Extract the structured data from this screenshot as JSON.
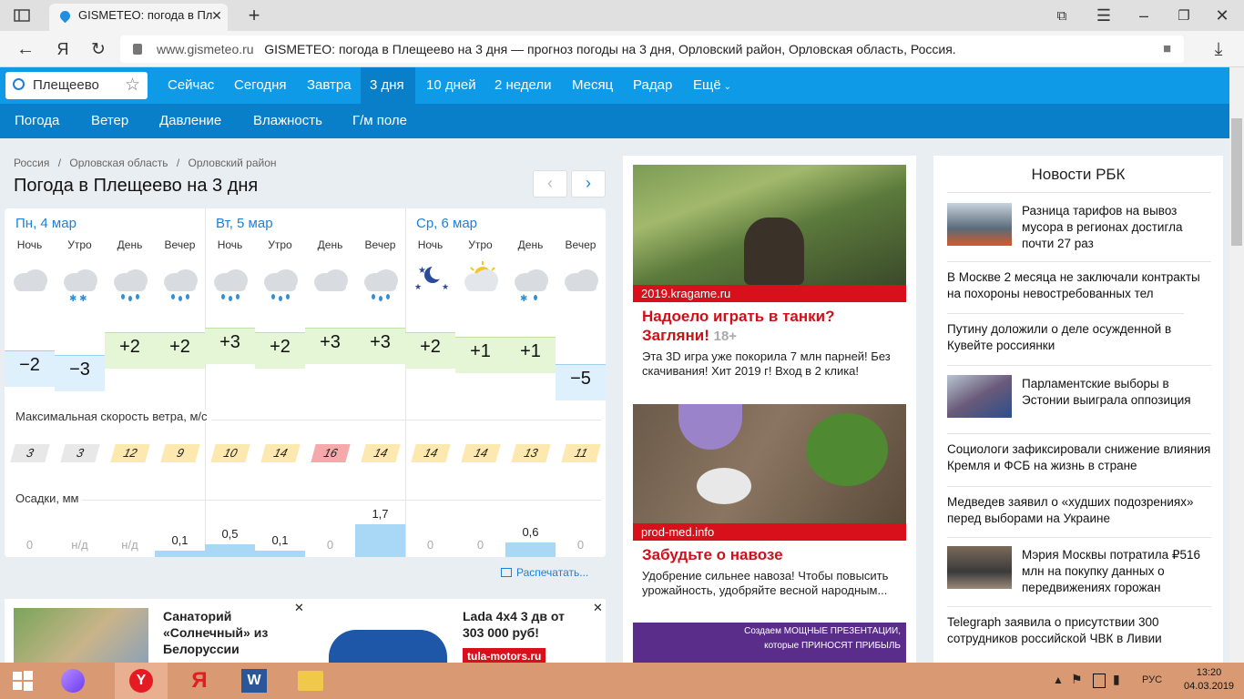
{
  "browser": {
    "tab_title": "GISMETEO: погода в Пл",
    "address_domain": "www.gismeteo.ru",
    "address_title": "GISMETEO: погода в Плещеево на 3 дня — прогноз погоды на 3 дня, Орловский район, Орловская область, Россия."
  },
  "nav": {
    "search_value": "Плещеево",
    "main": [
      "Сейчас",
      "Сегодня",
      "Завтра",
      "3 дня",
      "10 дней",
      "2 недели",
      "Месяц",
      "Радар",
      "Ещё"
    ],
    "sub": [
      "Погода",
      "Ветер",
      "Давление",
      "Влажность",
      "Г/м поле"
    ]
  },
  "page": {
    "breadcrumbs": [
      "Россия",
      "/",
      "Орловская область",
      "/",
      "Орловский район"
    ],
    "title": "Погода в Плещеево на 3 дня",
    "print_label": "Распечатать..."
  },
  "forecast": {
    "days": [
      "Пн, 4 мар",
      "Вт, 5 мар",
      "Ср, 6 мар"
    ],
    "parts": [
      "Ночь",
      "Утро",
      "День",
      "Вечер",
      "Ночь",
      "Утро",
      "День",
      "Вечер",
      "Ночь",
      "Утро",
      "День",
      "Вечер"
    ],
    "icons": [
      "cloudy-icon",
      "cloudy-snow-icon",
      "cloudy-rain-icon",
      "cloudy-rain-icon",
      "cloudy-rain-icon",
      "cloudy-rain-icon",
      "cloudy-icon",
      "cloudy-rain-icon",
      "moon-stars-icon",
      "partly-sunny-icon",
      "cloudy-sleet-icon",
      "cloudy-icon"
    ],
    "temps": [
      "−2",
      "−3",
      "+2",
      "+2",
      "+3",
      "+2",
      "+3",
      "+3",
      "+2",
      "+1",
      "+1",
      "−5"
    ],
    "temp_values": [
      -2,
      -3,
      2,
      2,
      3,
      2,
      3,
      3,
      2,
      1,
      1,
      -5
    ],
    "wind_label": "Максимальная скорость ветра, м/с",
    "wind": [
      "3",
      "3",
      "12",
      "9",
      "10",
      "14",
      "16",
      "14",
      "14",
      "14",
      "13",
      "11"
    ],
    "precip_label": "Осадки, мм",
    "precip": [
      "0",
      "н/д",
      "н/д",
      "0,1",
      "0,5",
      "0,1",
      "0",
      "1,7",
      "0",
      "0",
      "0,6",
      "0"
    ],
    "precip_values": [
      0,
      0,
      0,
      0.1,
      0.5,
      0.1,
      0,
      1.7,
      0,
      0,
      0.6,
      0
    ]
  },
  "bottom_ads": {
    "ad1": "Санаторий «Солнечный» из Белоруссии",
    "ad2_title": "Lada 4x4 3 дв от 303 000 руб!",
    "ad2_source": "tula-motors.ru"
  },
  "mid_ads": [
    {
      "source": "2019.kragame.ru",
      "title": "Надоело играть в танки? Загляни!",
      "age": "18+",
      "text": "Эта 3D игра уже покорила 7 млн парней! Без скачивания! Хит 2019 г! Вход в 2 клика!"
    },
    {
      "source": "prod-med.info",
      "title": "Забудьте о навозе",
      "text": "Удобрение сильнее навоза! Чтобы повысить урожайность, удобряйте весной народным..."
    },
    {
      "banner_text": "Создаем МОЩНЫЕ ПРЕЗЕНТАЦИИ, которые ПРИНОСЯТ ПРИБЫЛЬ"
    }
  ],
  "news": {
    "header": "Новости РБК",
    "items": [
      "Разница тарифов на вывоз мусора в регионах достигла почти 27 раз",
      "В Москве 2 месяца не заключали контракты на похороны невостребованных тел",
      "Путину доложили о деле осужденной в Кувейте россиянки",
      "Парламентские выборы в Эстонии выиграла оппозиция",
      "Социологи зафиксировали снижение влияния Кремля и ФСБ на жизнь в стране",
      "Медведев заявил о «худших подозрениях» перед выборами на Украине",
      "Мэрия Москвы потратила ₽516 млн на покупку данных о передвижениях горожан",
      "Telegraph заявила о присутствии 300 сотрудников российской ЧВК в Ливии"
    ]
  },
  "taskbar": {
    "lang": "РУС",
    "time": "13:20",
    "date": "04.03.2019"
  },
  "colors": {
    "nav_primary": "#0f9ae8",
    "nav_secondary": "#0a7fc9",
    "ad_red": "#d8101c",
    "taskbar": "#d99a73"
  }
}
